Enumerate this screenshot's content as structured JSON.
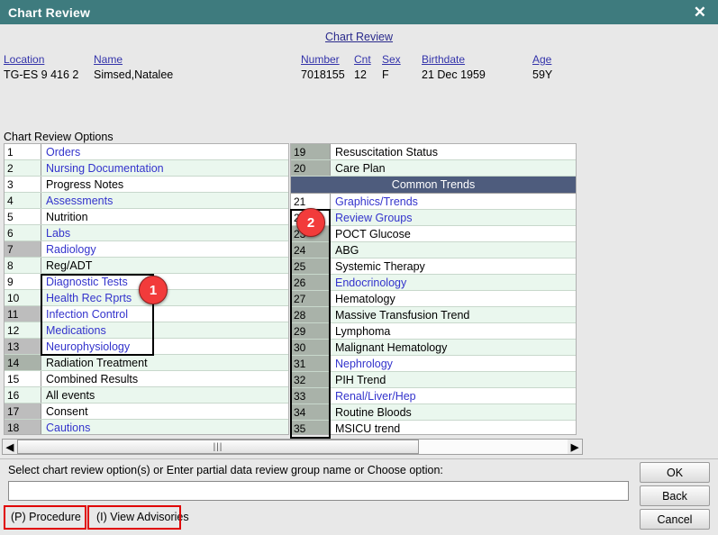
{
  "window": {
    "title": "Chart Review",
    "close_icon": "close-icon",
    "subtitle": "Chart Review"
  },
  "patient": {
    "fields": [
      {
        "label": "Location",
        "value": "TG-ES 9 416 2"
      },
      {
        "label": "Name",
        "value": "Simsed,Natalee"
      },
      {
        "label": "Number",
        "value": "7018155"
      },
      {
        "label": "Cnt",
        "value": "12"
      },
      {
        "label": "Sex",
        "value": "F"
      },
      {
        "label": "Birthdate",
        "value": "21 Dec 1959"
      },
      {
        "label": "Age",
        "value": "59Y"
      }
    ]
  },
  "options_label": "Chart Review Options",
  "left_list": [
    {
      "num": "1",
      "text": "Orders",
      "link": true
    },
    {
      "num": "2",
      "text": "Nursing Documentation",
      "link": true
    },
    {
      "num": "3",
      "text": "Progress Notes",
      "link": false
    },
    {
      "num": "4",
      "text": "Assessments",
      "link": true
    },
    {
      "num": "5",
      "text": "Nutrition",
      "link": false
    },
    {
      "num": "6",
      "text": "Labs",
      "link": true
    },
    {
      "num": "7",
      "text": "Radiology",
      "link": true
    },
    {
      "num": "8",
      "text": "Reg/ADT",
      "link": false
    },
    {
      "num": "9",
      "text": "Diagnostic Tests",
      "link": true
    },
    {
      "num": "10",
      "text": "Health Rec Rprts",
      "link": true
    },
    {
      "num": "11",
      "text": "Infection Control",
      "link": true
    },
    {
      "num": "12",
      "text": "Medications",
      "link": true
    },
    {
      "num": "13",
      "text": "Neurophysiology",
      "link": true
    },
    {
      "num": "14",
      "text": "Radiation Treatment",
      "link": false
    },
    {
      "num": "15",
      "text": "Combined Results",
      "link": false
    },
    {
      "num": "16",
      "text": "All events",
      "link": false
    },
    {
      "num": "17",
      "text": "Consent",
      "link": false
    },
    {
      "num": "18",
      "text": "Cautions",
      "link": true
    }
  ],
  "right_list": [
    {
      "num": "19",
      "text": "Resuscitation Status",
      "link": false
    },
    {
      "num": "20",
      "text": "Care Plan",
      "link": false
    },
    {
      "section": "Common Trends"
    },
    {
      "num": "21",
      "text": "Graphics/Trends",
      "link": true
    },
    {
      "num": "22",
      "text": "Review Groups",
      "link": true
    },
    {
      "num": "23",
      "text": "POCT Glucose",
      "link": false
    },
    {
      "num": "24",
      "text": "ABG",
      "link": false
    },
    {
      "num": "25",
      "text": "Systemic Therapy",
      "link": false
    },
    {
      "num": "26",
      "text": "Endocrinology",
      "link": true
    },
    {
      "num": "27",
      "text": "Hematology",
      "link": false
    },
    {
      "num": "28",
      "text": "Massive Transfusion Trend",
      "link": false
    },
    {
      "num": "29",
      "text": "Lymphoma",
      "link": false
    },
    {
      "num": "30",
      "text": "Malignant Hematology",
      "link": false
    },
    {
      "num": "31",
      "text": "Nephrology",
      "link": true
    },
    {
      "num": "32",
      "text": "PIH Trend",
      "link": false
    },
    {
      "num": "33",
      "text": "Renal/Liver/Hep",
      "link": true
    },
    {
      "num": "34",
      "text": "Routine Bloods",
      "link": false
    },
    {
      "num": "35",
      "text": "MSICU trend",
      "link": false
    }
  ],
  "annotations": {
    "marker_1": "1",
    "marker_2": "2"
  },
  "scrollbar": {
    "left_arrow": "◀",
    "right_arrow": "▶",
    "grip": "|||"
  },
  "bottom": {
    "prompt": "Select chart review option(s) or Enter partial data review group name or Choose option:",
    "entry_value": "",
    "entry_placeholder": "",
    "procedure_label": "(P) Procedure",
    "advisories_label": "(I) View Advisories"
  },
  "actions": {
    "ok": "OK",
    "back": "Back",
    "cancel": "Cancel"
  },
  "colors": {
    "titlebar": "#3e7b7e",
    "section_header": "#4e5c7d",
    "link": "#3333cc",
    "annotation_red": "#e00000",
    "marker": "#f23b3b"
  }
}
